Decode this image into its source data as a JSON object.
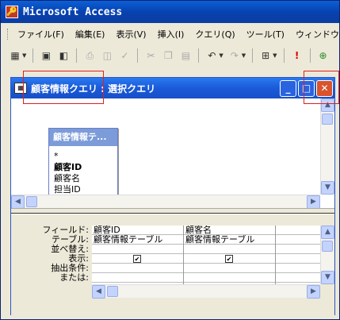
{
  "app": {
    "title": "Microsoft Access"
  },
  "menu": [
    "ファイル(F)",
    "編集(E)",
    "表示(V)",
    "挿入(I)",
    "クエリ(Q)",
    "ツール(T)",
    "ウィンドウ(W)"
  ],
  "toolbar": {
    "items": [
      "view",
      "save",
      "search",
      "print",
      "print-preview",
      "spelling",
      "cut",
      "copy",
      "paste",
      "undo",
      "redo",
      "query-type",
      "run",
      "show-table"
    ]
  },
  "window": {
    "title": "顧客情報クエリ : 選択クエリ"
  },
  "table_box": {
    "title": "顧客情報テ...",
    "fields": [
      "*",
      "顧客ID",
      "顧客名",
      "担当ID"
    ]
  },
  "grid": {
    "row_labels": [
      "フィールド:",
      "テーブル:",
      "並べ替え:",
      "表示:",
      "抽出条件:",
      "または:"
    ],
    "columns": [
      {
        "field": "顧客ID",
        "table": "顧客情報テーブル",
        "show": true
      },
      {
        "field": "顧客名",
        "table": "顧客情報テーブル",
        "show": true
      }
    ]
  },
  "checkmark": "✔"
}
